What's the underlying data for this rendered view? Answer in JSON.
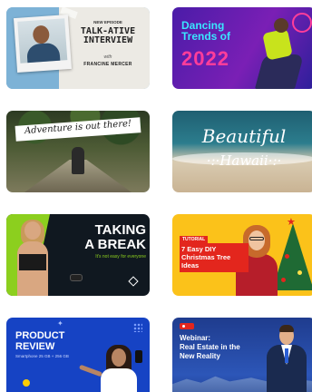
{
  "templates": [
    {
      "id": "talk-ative-interview",
      "kicker": "NEW EPISODE",
      "title_line1": "TALK-ATIVE",
      "title_line2": "INTERVIEW",
      "with": "with",
      "guest": "FRANCINE MERCER"
    },
    {
      "id": "dancing-trends",
      "title_line1": "Dancing",
      "title_line2": "Trends of",
      "year": "2022"
    },
    {
      "id": "adventure",
      "title": "Adventure is out there!"
    },
    {
      "id": "beautiful-hawaii",
      "title_line1": "Beautiful",
      "title_line2": "·:·Hawaii·:·"
    },
    {
      "id": "taking-a-break",
      "title_line1": "TAKING",
      "title_line2": "A BREAK",
      "subtitle": "It's not easy for everyone"
    },
    {
      "id": "christmas-tree-ideas",
      "tag": "TUTORIAL",
      "title_line1": "7 Easy DIY",
      "title_line2": "Christmas Tree",
      "title_line3": "Ideas"
    },
    {
      "id": "product-review",
      "title_line1": "PRODUCT",
      "title_line2": "REVIEW",
      "subtitle": "Smartphone 25 GB + 256 GB"
    },
    {
      "id": "webinar-real-estate",
      "title_line1": "Webinar:",
      "title_line2": "Real Estate in the",
      "title_line3": "New Reality"
    }
  ],
  "icons": {
    "card5_corner": "diamond-icon",
    "card6_star": "star-icon",
    "card8_badge": "record-icon"
  },
  "colors": {
    "dancing_title": "#3ae6ff",
    "dancing_year": "#ff3d9a",
    "break_accent": "#8ccf1e",
    "tutorial_red": "#e3261d",
    "tutorial_yellow": "#fbc21a",
    "review_blue": "#1643c4",
    "webinar_blue": "#2c56b8"
  }
}
